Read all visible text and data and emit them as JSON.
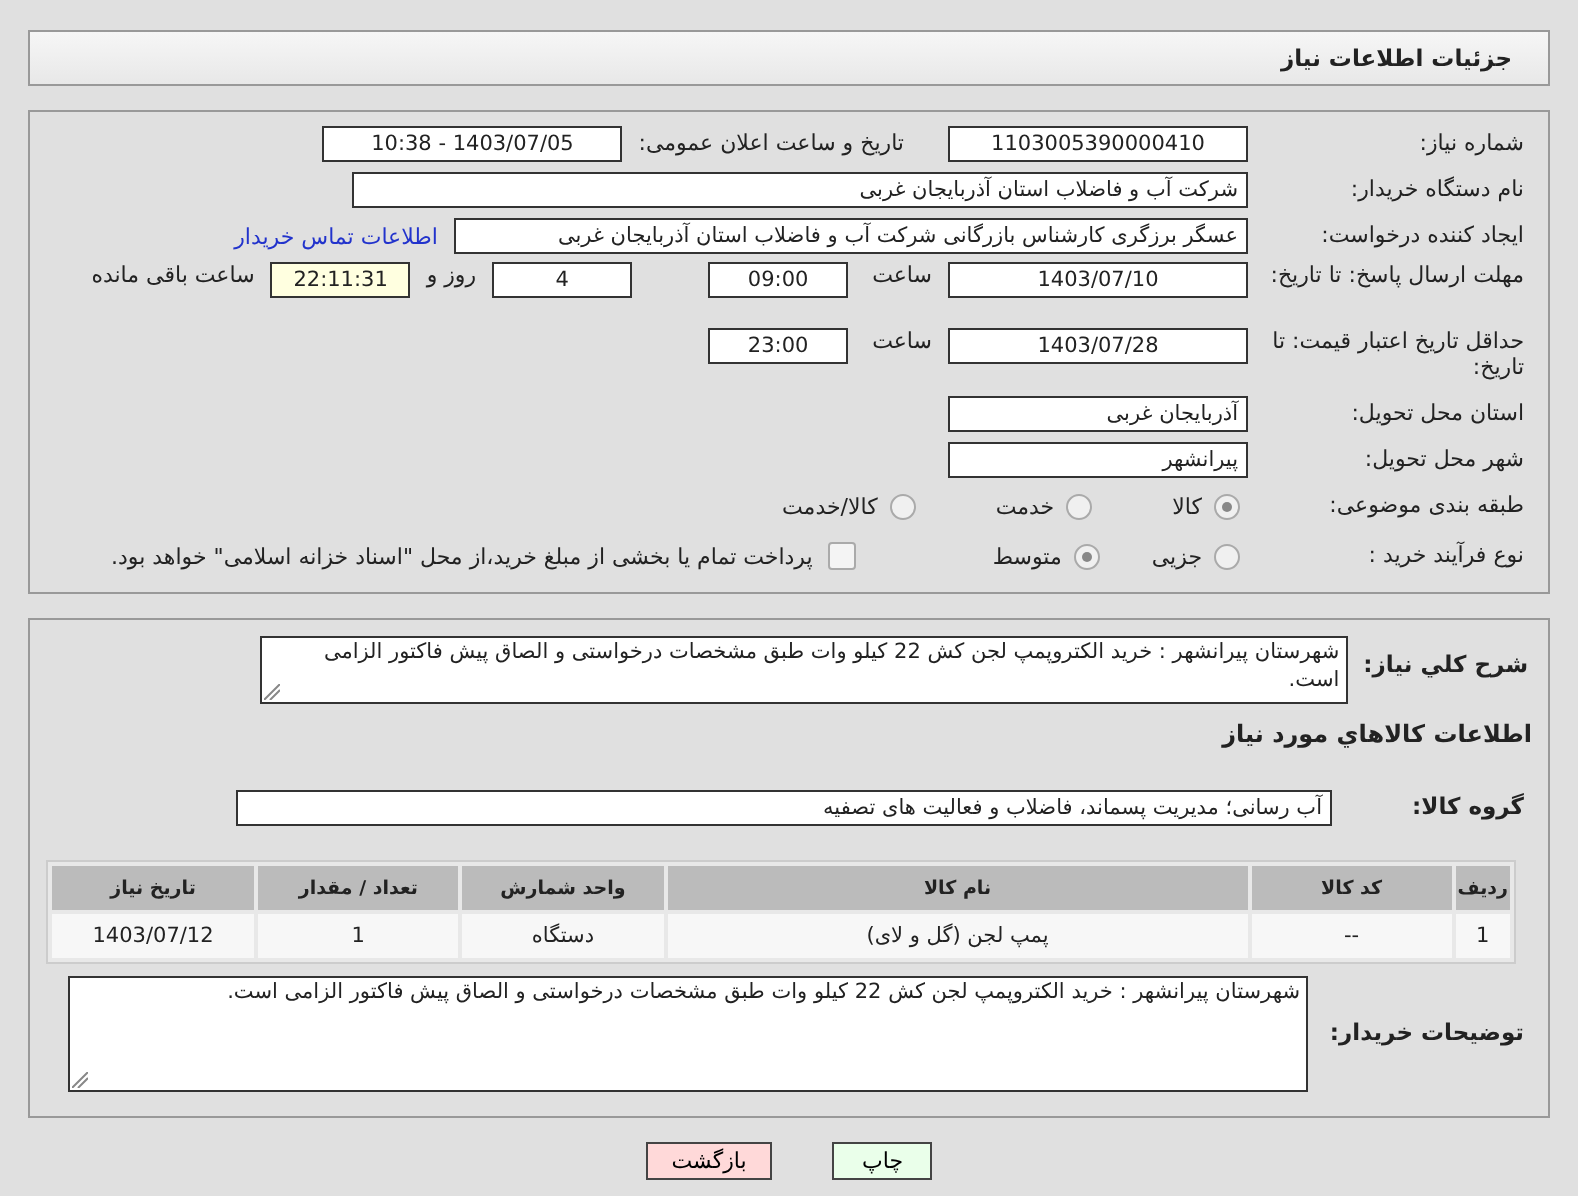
{
  "header": {
    "title": "جزئیات اطلاعات نیاز"
  },
  "need_number": {
    "label": "شماره نیاز:",
    "value": "1103005390000410"
  },
  "announce": {
    "label": "تاریخ و ساعت اعلان عمومی:",
    "value": "1403/07/05 - 10:38"
  },
  "buyer_org": {
    "label": "نام دستگاه خریدار:",
    "value": "شرکت آب و فاضلاب استان آذربایجان غربی"
  },
  "requester": {
    "label": "ایجاد کننده درخواست:",
    "value": "عسگر  برزگری کارشناس بازرگانی شرکت آب و فاضلاب استان آذربایجان غربی",
    "link": "اطلاعات تماس خریدار"
  },
  "response_deadline": {
    "label": "مهلت ارسال پاسخ: تا تاریخ:",
    "date": "1403/07/10",
    "time_label": "ساعت",
    "time": "09:00",
    "days": "4",
    "days_label": "روز و",
    "remaining": "22:11:31",
    "remaining_label": "ساعت باقی مانده"
  },
  "price_validity": {
    "label": "حداقل تاریخ اعتبار قیمت: تا تاریخ:",
    "date": "1403/07/28",
    "time_label": "ساعت",
    "time": "23:00"
  },
  "province": {
    "label": "استان محل تحویل:",
    "value": "آذربایجان غربی"
  },
  "city": {
    "label": "شهر محل تحویل:",
    "value": "پیرانشهر"
  },
  "category": {
    "label": "طبقه بندی موضوعی:",
    "options": [
      {
        "label": "کالا",
        "selected": true
      },
      {
        "label": "خدمت",
        "selected": false
      },
      {
        "label": "کالا/خدمت",
        "selected": false
      }
    ]
  },
  "purchase_process": {
    "label": "نوع فرآیند خرید :",
    "options": [
      {
        "label": "جزیی",
        "selected": false
      },
      {
        "label": "متوسط",
        "selected": true
      }
    ],
    "treasury": {
      "checked": false,
      "text": "پرداخت تمام یا بخشی از مبلغ خرید،از محل \"اسناد خزانه اسلامی\" خواهد بود."
    }
  },
  "description": {
    "label": "شرح کلي نياز:",
    "value": "شهرستان پیرانشهر : خرید  الکتروپمپ لجن کش 22 کیلو وات طبق مشخصات درخواستی و الصاق پیش فاکتور الزامی است."
  },
  "goods_title": "اطلاعات کالاهاي مورد نياز",
  "goods_group": {
    "label": "گروه کالا:",
    "value": "آب رسانی؛ مدیریت پسماند، فاضلاب و فعالیت های تصفیه"
  },
  "table": {
    "columns": [
      "ردیف",
      "کد کالا",
      "نام کالا",
      "واحد شمارش",
      "تعداد / مقدار",
      "تاریخ نیاز"
    ],
    "rows": [
      [
        "1",
        "--",
        "پمپ لجن (گل و لای)",
        "دستگاه",
        "1",
        "1403/07/12"
      ]
    ]
  },
  "buyer_notes": {
    "label": "توضیحات خریدار:",
    "value": "شهرستان پیرانشهر : خرید  الکتروپمپ لجن کش 22 کیلو وات طبق مشخصات درخواستی و الصاق پیش فاکتور الزامی است."
  },
  "buttons": [
    {
      "kind": "print",
      "label": "چاپ"
    },
    {
      "kind": "back",
      "label": "بازگشت"
    }
  ]
}
